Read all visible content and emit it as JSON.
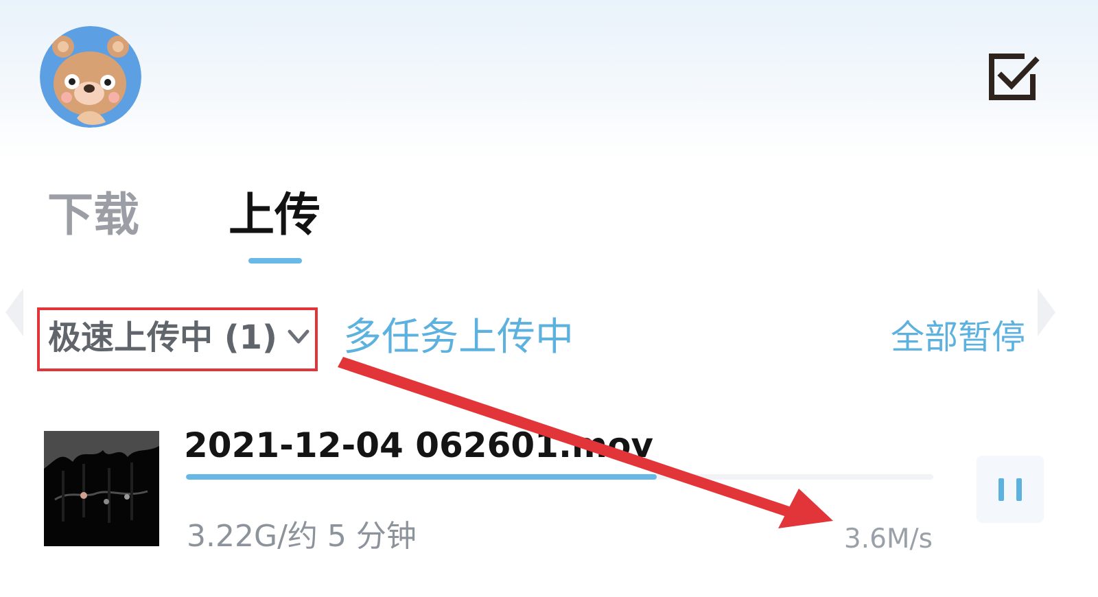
{
  "header": {
    "avatar_icon": "bear-avatar-icon",
    "action_icon": "check-square-icon"
  },
  "tabs": [
    {
      "label": "下载",
      "selected": false
    },
    {
      "label": "上传",
      "selected": true
    }
  ],
  "upload_controls": {
    "filter_label": "极速上传中 (1)",
    "filter_icon": "chevron-down-icon",
    "multi_task_label": "多任务上传中",
    "pause_all_label": "全部暂停"
  },
  "upload_item": {
    "file_name": "2021-12-04 062601.mov",
    "progress": 0.63,
    "meta": "3.22G/约 5 分钟",
    "speed": "3.6M/s",
    "thumbnail_icon": "video-thumbnail-icon",
    "pause_icon": "pause-icon"
  },
  "annotation": {
    "arrow_color": "#e1353a"
  },
  "colors": {
    "accent": "#5cb1df",
    "annotation": "#e1353a"
  }
}
